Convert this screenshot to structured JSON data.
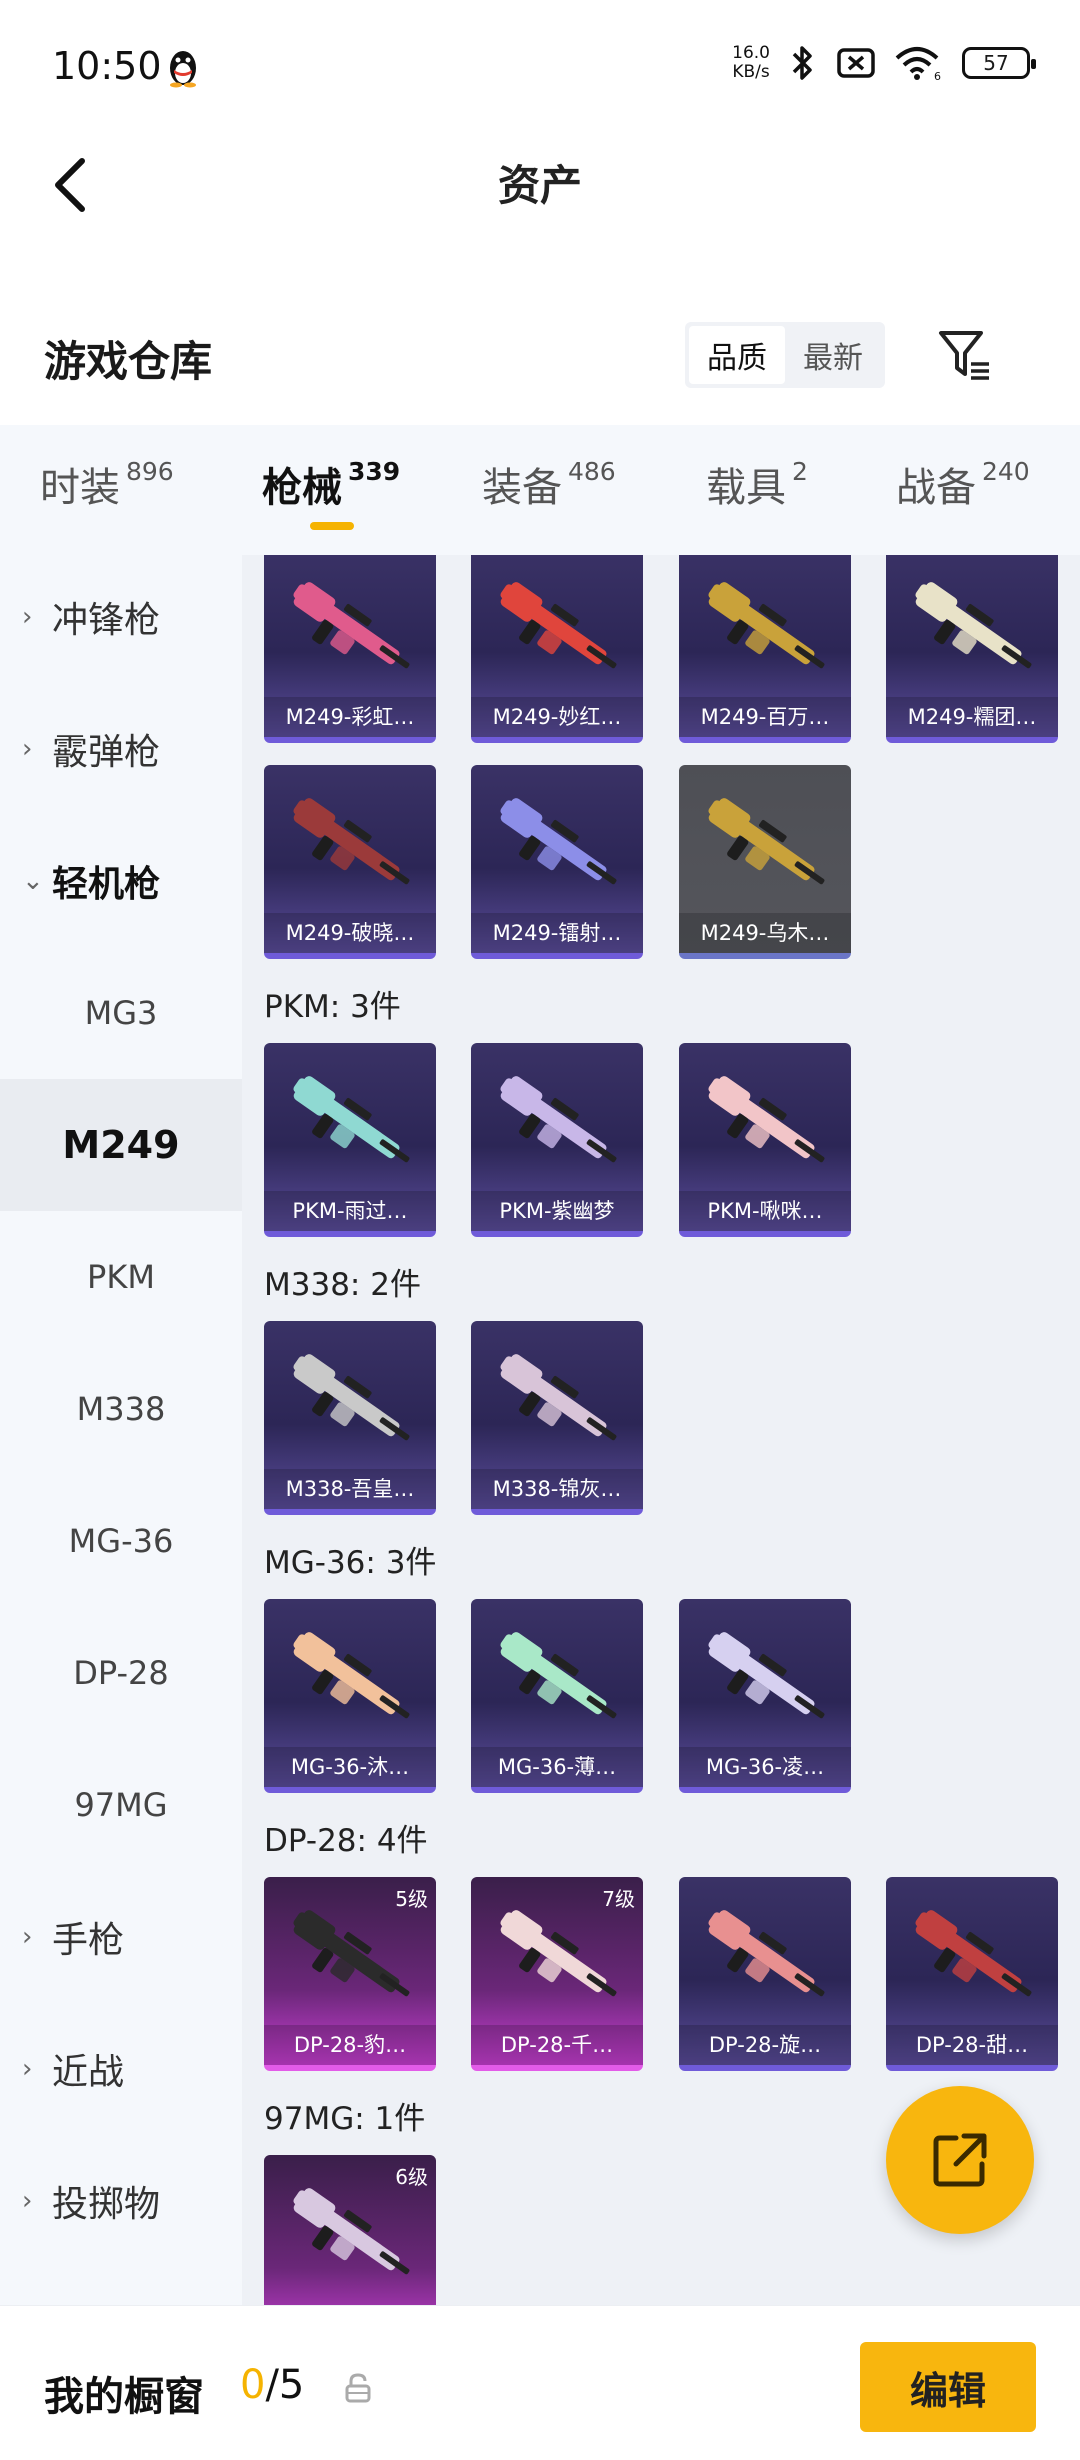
{
  "status_bar": {
    "time": "10:50",
    "net_speed_value": "16.0",
    "net_speed_unit": "KB/s",
    "battery": "57",
    "icons": [
      "qq-penguin-icon",
      "bluetooth-icon",
      "sim-off-icon",
      "wifi-icon",
      "battery-icon"
    ]
  },
  "header": {
    "title": "资产"
  },
  "warehouse": {
    "title": "游戏仓库",
    "sort_options": [
      "品质",
      "最新"
    ],
    "active_sort": "品质"
  },
  "tabs": [
    {
      "label": "时装",
      "count": "896"
    },
    {
      "label": "枪械",
      "count": "339",
      "active": true
    },
    {
      "label": "装备",
      "count": "486"
    },
    {
      "label": "载具",
      "count": "2"
    },
    {
      "label": "战备",
      "count": "240"
    }
  ],
  "sidebar": {
    "items": [
      {
        "label": "冲锋枪",
        "type": "category",
        "chevron": "›"
      },
      {
        "label": "霰弹枪",
        "type": "category",
        "chevron": "›"
      },
      {
        "label": "轻机枪",
        "type": "category",
        "chevron": "⌄",
        "open": true
      },
      {
        "label": "MG3",
        "type": "sub"
      },
      {
        "label": "M249",
        "type": "sub",
        "active": true
      },
      {
        "label": "PKM",
        "type": "sub"
      },
      {
        "label": "M338",
        "type": "sub"
      },
      {
        "label": "MG-36",
        "type": "sub"
      },
      {
        "label": "DP-28",
        "type": "sub"
      },
      {
        "label": "97MG",
        "type": "sub"
      },
      {
        "label": "手枪",
        "type": "category",
        "chevron": "›"
      },
      {
        "label": "近战",
        "type": "category",
        "chevron": "›"
      },
      {
        "label": "投掷物",
        "type": "category",
        "chevron": "›"
      }
    ]
  },
  "groups": [
    {
      "title": "",
      "items": [
        {
          "name": "M249-彩虹…",
          "tint": "#e05b8c",
          "style": "purple"
        },
        {
          "name": "M249-妙红…",
          "tint": "#e0453c",
          "style": "purple"
        },
        {
          "name": "M249-百万…",
          "tint": "#c9a23a",
          "style": "purple"
        },
        {
          "name": "M249-糯团…",
          "tint": "#e8e2c8",
          "style": "purple"
        },
        {
          "name": "M249-破晓…",
          "tint": "#9b3a3a",
          "style": "purple"
        },
        {
          "name": "M249-镭射…",
          "tint": "#8c8ee8",
          "style": "purple"
        },
        {
          "name": "M249-乌木…",
          "tint": "#c9a23a",
          "style": "gray"
        }
      ]
    },
    {
      "title": "PKM: 3件",
      "items": [
        {
          "name": "PKM-雨过…",
          "tint": "#8fd9d2",
          "style": "purple"
        },
        {
          "name": "PKM-紫幽梦",
          "tint": "#c8b7e8",
          "style": "purple"
        },
        {
          "name": "PKM-啾咪…",
          "tint": "#f2c5c8",
          "style": "purple"
        }
      ]
    },
    {
      "title": "M338: 2件",
      "items": [
        {
          "name": "M338-吾皇…",
          "tint": "#c9c9c9",
          "style": "purple"
        },
        {
          "name": "M338-锦灰…",
          "tint": "#d8c4d8",
          "style": "purple"
        }
      ]
    },
    {
      "title": "MG-36: 3件",
      "items": [
        {
          "name": "MG-36-沐…",
          "tint": "#f2c19b",
          "style": "purple"
        },
        {
          "name": "MG-36-薄…",
          "tint": "#a9e8c8",
          "style": "purple"
        },
        {
          "name": "MG-36-凌…",
          "tint": "#d6d0f0",
          "style": "purple"
        }
      ]
    },
    {
      "title": "DP-28: 4件",
      "items": [
        {
          "name": "DP-28-豹…",
          "tint": "#2b2b2b",
          "style": "pink",
          "level": "5级"
        },
        {
          "name": "DP-28-千…",
          "tint": "#f0d8d8",
          "style": "pink",
          "level": "7级"
        },
        {
          "name": "DP-28-旋…",
          "tint": "#e89090",
          "style": "purple"
        },
        {
          "name": "DP-28-甜…",
          "tint": "#c04040",
          "style": "purple"
        }
      ]
    },
    {
      "title": "97MG: 1件",
      "items": [
        {
          "name": "",
          "tint": "#d8c8e0",
          "style": "pink",
          "level": "6级"
        }
      ]
    }
  ],
  "bottom": {
    "label": "我的橱窗",
    "current": "0",
    "total": "/5",
    "edit": "编辑"
  },
  "colors": {
    "accent": "#f8b60e",
    "card_purple": "#2c2656",
    "card_pink": "#c93fd4"
  }
}
